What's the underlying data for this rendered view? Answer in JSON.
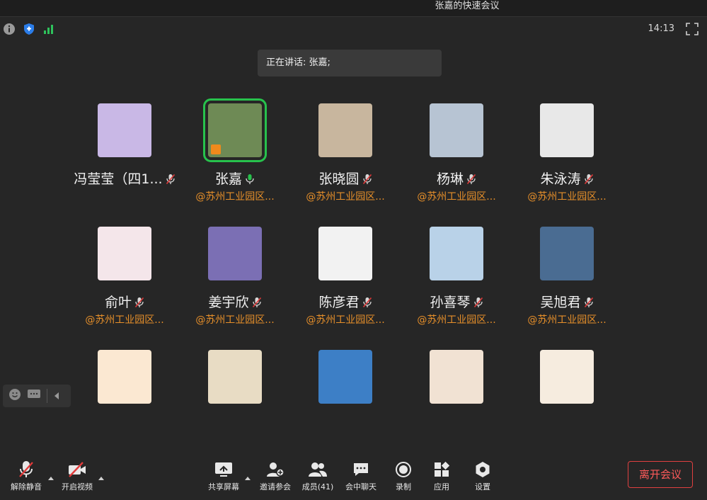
{
  "window": {
    "title": "张嘉的快速会议"
  },
  "status": {
    "time": "14:13"
  },
  "speaker_banner": "正在讲话: 张嘉;",
  "participants": [
    {
      "name": "冯莹莹（四1...",
      "org": "",
      "mic": "muted",
      "active": false,
      "avatar_color": "#c9b8e6"
    },
    {
      "name": "张嘉",
      "org": "@苏州工业园区...",
      "mic": "on",
      "active": true,
      "avatar_color": "#6e8a55"
    },
    {
      "name": "张晓圆",
      "org": "@苏州工业园区...",
      "mic": "muted",
      "active": false,
      "avatar_color": "#c8b69e"
    },
    {
      "name": "杨琳",
      "org": "@苏州工业园区...",
      "mic": "muted",
      "active": false,
      "avatar_color": "#b7c4d3"
    },
    {
      "name": "朱泳涛",
      "org": "@苏州工业园区...",
      "mic": "muted",
      "active": false,
      "avatar_color": "#e8e8e8"
    },
    {
      "name": "俞叶",
      "org": "@苏州工业园区...",
      "mic": "muted",
      "active": false,
      "avatar_color": "#f4e6ea"
    },
    {
      "name": "姜宇欣",
      "org": "@苏州工业园区...",
      "mic": "muted",
      "active": false,
      "avatar_color": "#7b6fb4"
    },
    {
      "name": "陈彦君",
      "org": "@苏州工业园区...",
      "mic": "muted",
      "active": false,
      "avatar_color": "#f2f2f2"
    },
    {
      "name": "孙喜琴",
      "org": "@苏州工业园区...",
      "mic": "muted",
      "active": false,
      "avatar_color": "#b9d2e8"
    },
    {
      "name": "吴旭君",
      "org": "@苏州工业园区...",
      "mic": "muted",
      "active": false,
      "avatar_color": "#4a6c92"
    },
    {
      "name": "",
      "org": "",
      "mic": "none",
      "active": false,
      "avatar_color": "#fbe8d2"
    },
    {
      "name": "",
      "org": "",
      "mic": "none",
      "active": false,
      "avatar_color": "#e8dcc4"
    },
    {
      "name": "",
      "org": "",
      "mic": "none",
      "active": false,
      "avatar_color": "#3d7fc6"
    },
    {
      "name": "",
      "org": "",
      "mic": "none",
      "active": false,
      "avatar_color": "#f1e2d3"
    },
    {
      "name": "",
      "org": "",
      "mic": "none",
      "active": false,
      "avatar_color": "#f6ecdf"
    }
  ],
  "toolbar": {
    "unmute": "解除静音",
    "start_video": "开启视频",
    "share_screen": "共享屏幕",
    "invite": "邀请参会",
    "members": "成员(41)",
    "chat": "会中聊天",
    "record": "录制",
    "apps": "应用",
    "settings": "设置",
    "leave": "离开会议"
  },
  "colors": {
    "accent_green": "#27c24c",
    "org_orange": "#e8902a",
    "leave_red": "#e04040"
  }
}
